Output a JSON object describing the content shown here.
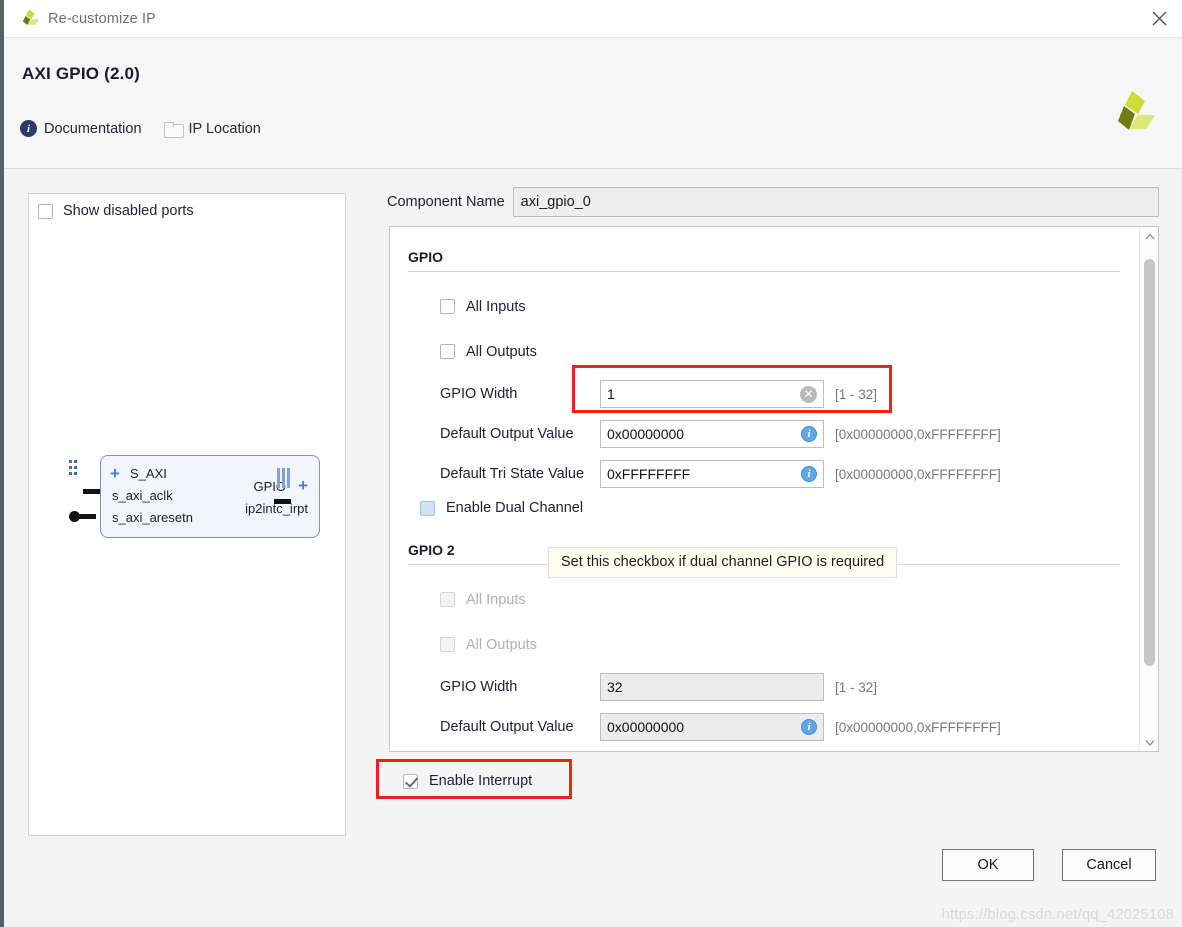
{
  "window": {
    "title": "Re-customize IP",
    "close_icon": "close-icon",
    "app_logo_icon": "xilinx-logo-icon"
  },
  "header": {
    "ip_title": "AXI GPIO (2.0)",
    "links": [
      {
        "label": "Documentation",
        "icon": "info-icon"
      },
      {
        "label": "IP Location",
        "icon": "folder-icon"
      }
    ],
    "logo_icon": "xilinx-logo-icon"
  },
  "preview": {
    "show_disabled_ports": {
      "label": "Show disabled ports",
      "checked": false
    },
    "block": {
      "left_ports": [
        "S_AXI",
        "s_axi_aclk",
        "s_axi_aresetn"
      ],
      "right_ports": [
        "GPIO",
        "ip2intc_irpt"
      ],
      "expand_icon": "plus-icon"
    }
  },
  "component": {
    "label": "Component Name",
    "value": "axi_gpio_0"
  },
  "gpio": {
    "section_title": "GPIO",
    "all_inputs": {
      "label": "All Inputs",
      "checked": false
    },
    "all_outputs": {
      "label": "All Outputs",
      "checked": false
    },
    "width": {
      "label": "GPIO Width",
      "value": "1",
      "hint": "[1 - 32]",
      "icon": "clear-icon",
      "highlighted": true
    },
    "default_output": {
      "label": "Default Output Value",
      "value": "0x00000000",
      "hint": "[0x00000000,0xFFFFFFFF]",
      "icon": "info-icon"
    },
    "default_tristate": {
      "label": "Default Tri State Value",
      "value": "0xFFFFFFFF",
      "hint": "[0x00000000,0xFFFFFFFF]",
      "icon": "info-icon"
    }
  },
  "dual_channel": {
    "label": "Enable Dual Channel",
    "checked": false,
    "hovered": true,
    "tooltip": "Set this checkbox if dual channel GPIO is required"
  },
  "gpio2": {
    "section_title": "GPIO 2",
    "disabled": true,
    "all_inputs": {
      "label": "All Inputs",
      "checked": false
    },
    "all_outputs": {
      "label": "All Outputs",
      "checked": false
    },
    "width": {
      "label": "GPIO Width",
      "value": "32",
      "hint": "[1 - 32]"
    },
    "default_output": {
      "label": "Default Output Value",
      "value": "0x00000000",
      "hint": "[0x00000000,0xFFFFFFFF]",
      "icon": "info-icon"
    }
  },
  "interrupt": {
    "label": "Enable Interrupt",
    "checked": true,
    "highlighted": true
  },
  "footer": {
    "ok_label": "OK",
    "cancel_label": "Cancel"
  },
  "watermark": "https://blog.csdn.net/qq_42025108",
  "colors": {
    "highlight_red": "#f02020",
    "accent_blue": "#4a7fd4",
    "tooltip_bg": "#fdfdf0",
    "logo_olive": "#6f7c14",
    "logo_lime": "#cddc39"
  }
}
